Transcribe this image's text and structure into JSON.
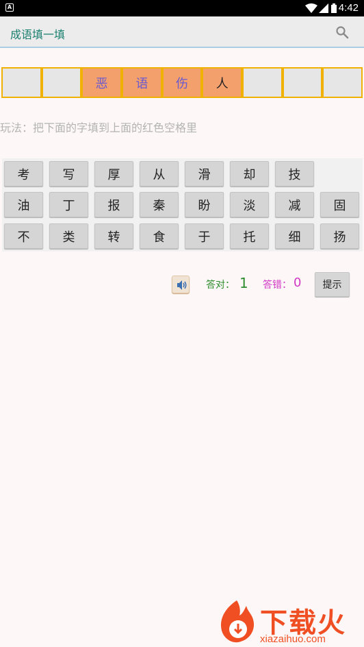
{
  "status_bar": {
    "time": "4:42"
  },
  "app_bar": {
    "title": "成语填一填"
  },
  "answer_slots": [
    "",
    "",
    "恶",
    "语",
    "伤",
    "人",
    "",
    "",
    ""
  ],
  "instruction": "玩法：把下面的字填到上面的红色空格里",
  "keys": [
    [
      "考",
      "写",
      "厚",
      "从",
      "滑",
      "却",
      "技"
    ],
    [
      "油",
      "丁",
      "报",
      "秦",
      "盼",
      "淡",
      "减",
      "固"
    ],
    [
      "不",
      "类",
      "转",
      "食",
      "于",
      "托",
      "细",
      "扬"
    ]
  ],
  "score": {
    "right_label": "答对：",
    "right_count": "1",
    "wrong_label": "答错：",
    "wrong_count": "0",
    "hint_label": "提示"
  },
  "watermark": {
    "brand": "下载火",
    "url": "xiazaihuo.com"
  },
  "colors": {
    "accent": "#1a7f6f",
    "slot_border": "#f0b100",
    "slot_active": "#f3a06c",
    "right": "#2d8c2d",
    "wrong": "#d136c4"
  }
}
